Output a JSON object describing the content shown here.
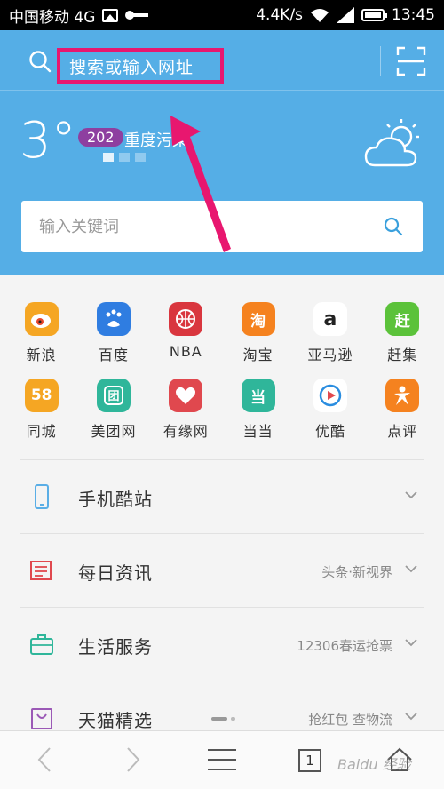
{
  "status_bar": {
    "carrier": "中国移动 4G",
    "speed": "4.4K/s",
    "time": "13:45"
  },
  "header": {
    "search_hint": "搜索或输入网址",
    "temperature": "3°",
    "aqi_value": "202",
    "aqi_label": "重度污染",
    "keyword_placeholder": "输入关键词",
    "accent_color": "#55aee6",
    "highlight_color": "#e8176f"
  },
  "grid": {
    "row1": [
      {
        "label": "新浪",
        "icon": "sina-weibo-icon",
        "color": "#f5a623"
      },
      {
        "label": "百度",
        "icon": "baidu-icon",
        "color": "#2f7de1"
      },
      {
        "label": "NBA",
        "icon": "nba-icon",
        "color": "#d9363e"
      },
      {
        "label": "淘宝",
        "icon": "taobao-icon",
        "glyph": "淘",
        "color": "#f5821f"
      },
      {
        "label": "亚马逊",
        "icon": "amazon-icon",
        "glyph": "a",
        "color": "#ffffff"
      },
      {
        "label": "赶集",
        "icon": "ganji-icon",
        "glyph": "赶",
        "color": "#5bc23a"
      }
    ],
    "row2": [
      {
        "label": "同城",
        "icon": "58-tongcheng-icon",
        "glyph": "58",
        "color": "#f5a623"
      },
      {
        "label": "美团网",
        "icon": "meituan-icon",
        "glyph": "团",
        "color": "#2fb69a"
      },
      {
        "label": "有缘网",
        "icon": "youyuan-icon",
        "color": "#e0484e"
      },
      {
        "label": "当当",
        "icon": "dangdang-icon",
        "glyph": "当",
        "color": "#2fb69a"
      },
      {
        "label": "优酷",
        "icon": "youku-icon",
        "color": "#ffffff"
      },
      {
        "label": "点评",
        "icon": "dianping-icon",
        "color": "#f5821f"
      }
    ]
  },
  "sections": [
    {
      "title": "手机酷站",
      "subtitle": "",
      "icon": "phone-icon",
      "color": "#5aaee6"
    },
    {
      "title": "每日资讯",
      "subtitle": "头条·新视界",
      "icon": "news-icon",
      "color": "#e0484e"
    },
    {
      "title": "生活服务",
      "subtitle": "12306春运抢票",
      "icon": "briefcase-icon",
      "color": "#2fb69a"
    },
    {
      "title": "天猫精选",
      "subtitle": "抢红包 查物流",
      "icon": "shopping-bag-icon",
      "color": "#9b59b6"
    }
  ],
  "bottom_nav": {
    "tab_count": "1",
    "watermark": "Baidu 经验"
  }
}
